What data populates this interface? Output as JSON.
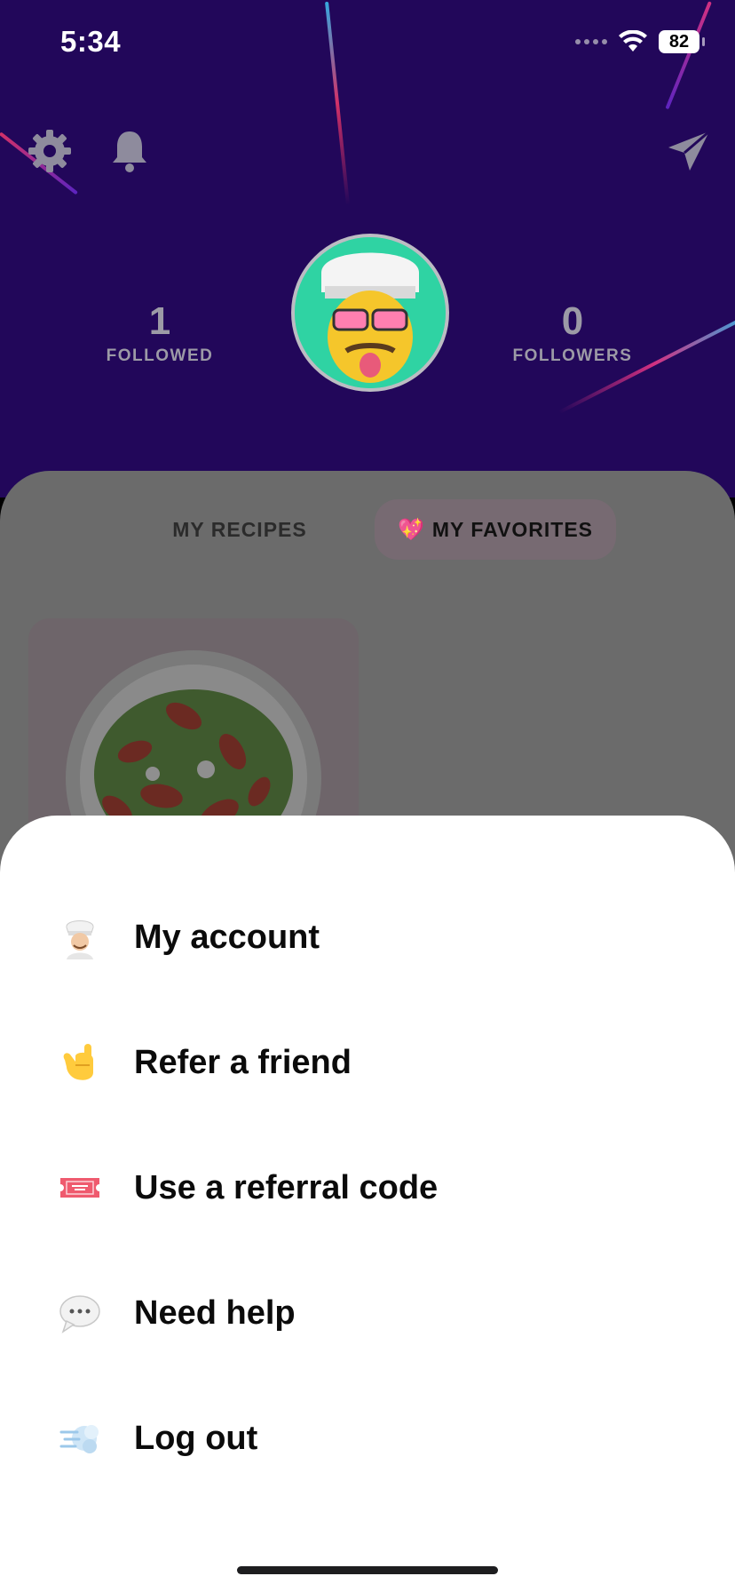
{
  "status_bar": {
    "time": "5:34",
    "battery": "82"
  },
  "profile": {
    "followed": {
      "count": "1",
      "label": "FOLLOWED"
    },
    "followers": {
      "count": "0",
      "label": "FOLLOWERS"
    }
  },
  "tabs": [
    {
      "label": "MY RECIPES",
      "active": false
    },
    {
      "emoji": "💖",
      "label": "MY FAVORITES",
      "active": true
    }
  ],
  "menu": [
    {
      "emoji": "🧑🏻‍🍳",
      "label": "My account"
    },
    {
      "emoji": "🤙",
      "label": "Refer a friend"
    },
    {
      "emoji": "🎟️",
      "label": "Use a referral code"
    },
    {
      "emoji": "💬",
      "label": "Need help"
    },
    {
      "emoji": "💨",
      "label": "Log out"
    }
  ],
  "icons": {
    "settings": "gear-icon",
    "notifications": "bell-icon",
    "share": "paper-plane-icon",
    "wifi": "wifi-icon",
    "signal": "signal-icon",
    "battery": "battery-icon"
  },
  "colors": {
    "header_bg": "#22075a",
    "overlay_bg": "#6b6b6b",
    "sheet_bg": "#ffffff",
    "text_primary": "#0b0b0b"
  }
}
